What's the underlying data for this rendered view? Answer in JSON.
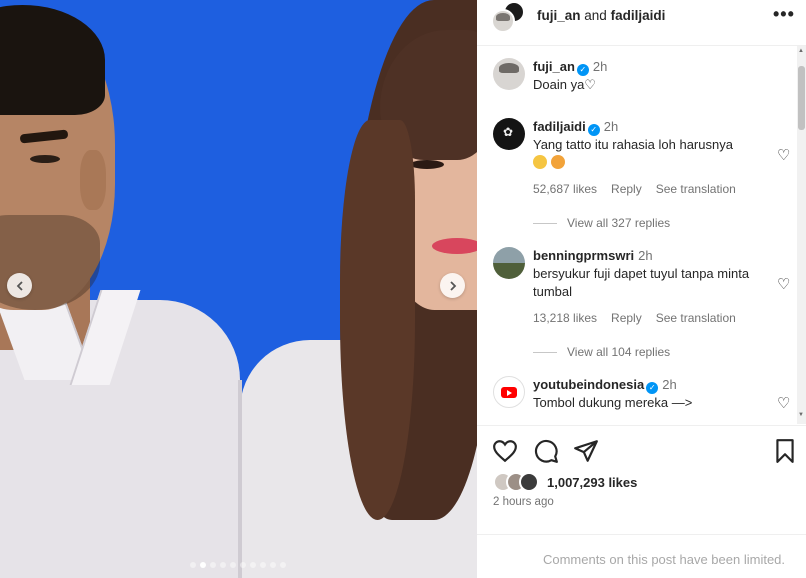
{
  "media": {
    "prev_icon": "chevron-left-icon",
    "next_icon": "chevron-right-icon",
    "dots_total": 10,
    "dots_active": 2
  },
  "header": {
    "user1": "fuji_an",
    "connector": "and",
    "user2": "fadiljaidi",
    "more_icon": "more-horizontal-icon",
    "more_glyph": "•••"
  },
  "comments": [
    {
      "username": "fuji_an",
      "verified": true,
      "time": "2h",
      "text": "Doain ya♡"
    },
    {
      "username": "fadiljaidi",
      "verified": true,
      "time": "2h",
      "text": "Yang tatto itu rahasia loh harusnya",
      "likes": "52,687 likes",
      "reply": "Reply",
      "translate": "See translation",
      "view_replies": "View all 327 replies"
    },
    {
      "username": "benningprmswri",
      "verified": false,
      "time": "2h",
      "text": "bersyukur fuji dapet tuyul tanpa minta tumbal",
      "likes": "13,218 likes",
      "reply": "Reply",
      "translate": "See translation",
      "view_replies": "View all 104 replies"
    },
    {
      "username": "youtubeindonesia",
      "verified": true,
      "time": "2h",
      "text": "Tombol dukung mereka —>"
    }
  ],
  "actions": {
    "like_icon": "heart-icon",
    "comment_icon": "comment-icon",
    "share_icon": "send-icon",
    "save_icon": "bookmark-icon",
    "likes_count": "1,007,293 likes",
    "post_time": "2 hours ago"
  },
  "footer": {
    "limited_text": "Comments on this post have been limited."
  }
}
